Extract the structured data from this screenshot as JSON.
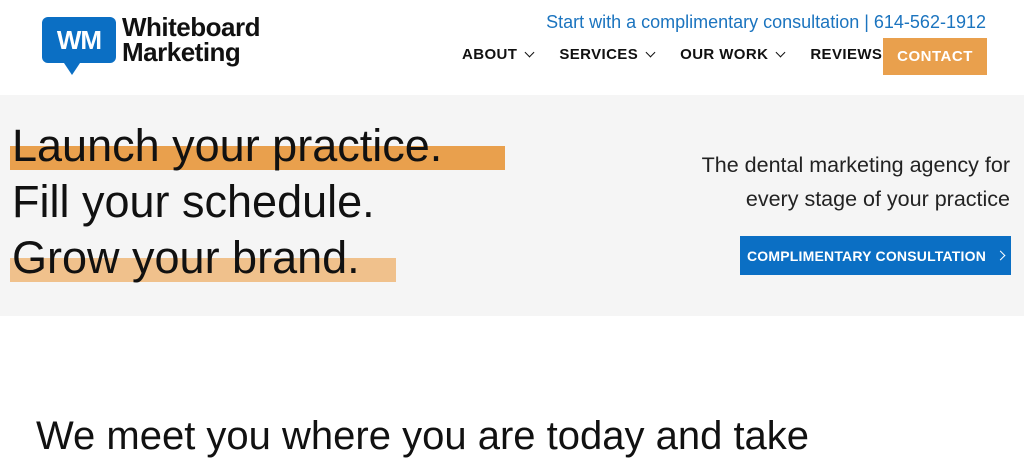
{
  "logo": {
    "badge": "WM",
    "line1": "Whiteboard",
    "line2": "Marketing"
  },
  "header": {
    "topline": "Start with a complimentary consultation | 614-562-1912",
    "nav": [
      "ABOUT",
      "SERVICES",
      "OUR WORK",
      "REVIEWS"
    ],
    "contact": "CONTACT"
  },
  "hero": {
    "line1": "Launch your practice.",
    "line2": "Fill your schedule.",
    "line3": "Grow your brand.",
    "tagline1": "The dental marketing agency for",
    "tagline2": "every stage of your practice",
    "cta": "COMPLIMENTARY CONSULTATION"
  },
  "section": {
    "heading": "We meet you where you are today and take"
  },
  "colors": {
    "blue": "#0b6fc4",
    "orange": "#e9a04d",
    "light_orange": "#f0c18c",
    "hero_bg": "#f5f5f5"
  }
}
